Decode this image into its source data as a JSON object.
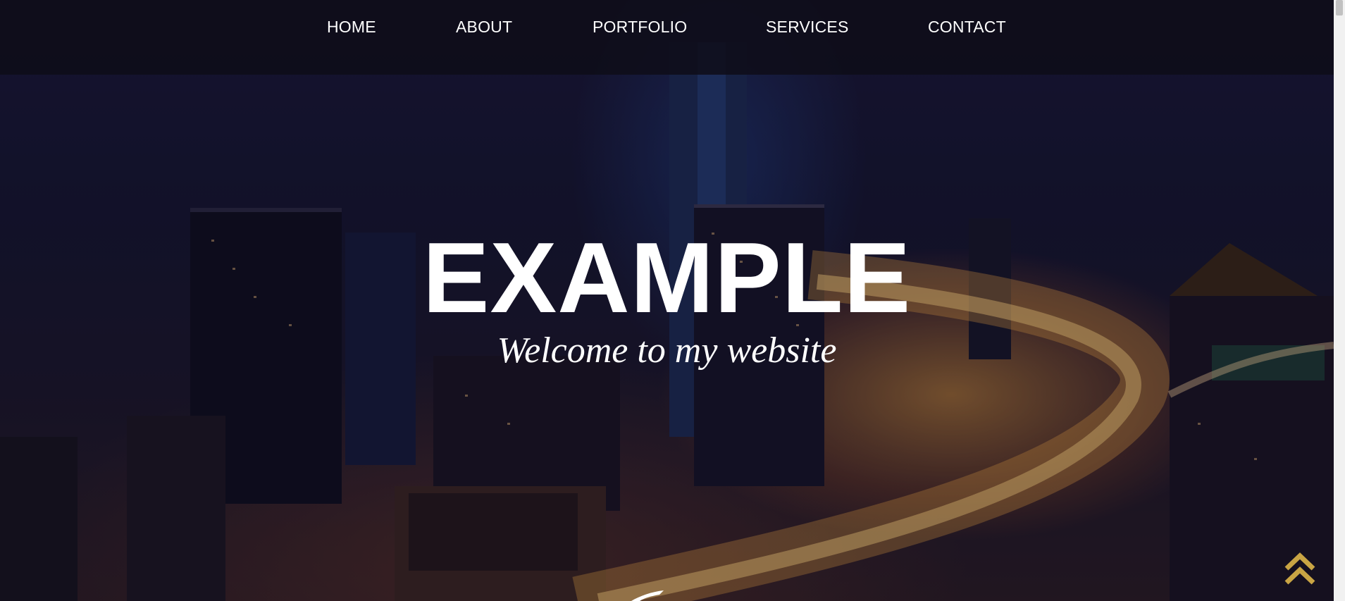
{
  "nav": {
    "items": [
      {
        "label": "HOME"
      },
      {
        "label": "ABOUT"
      },
      {
        "label": "PORTFOLIO"
      },
      {
        "label": "SERVICES"
      },
      {
        "label": "CONTACT"
      }
    ]
  },
  "hero": {
    "title": "EXAMPLE",
    "subtitle": "Welcome to my website",
    "background_icon": "night-city-skyline",
    "scroll_hint_icon": "chevron-down-icon"
  },
  "back_to_top": {
    "icon": "double-chevron-up-icon",
    "color": "#c9a544"
  },
  "colors": {
    "nav_background": "#0e0d18",
    "text": "#ffffff",
    "accent": "#c9a544"
  }
}
